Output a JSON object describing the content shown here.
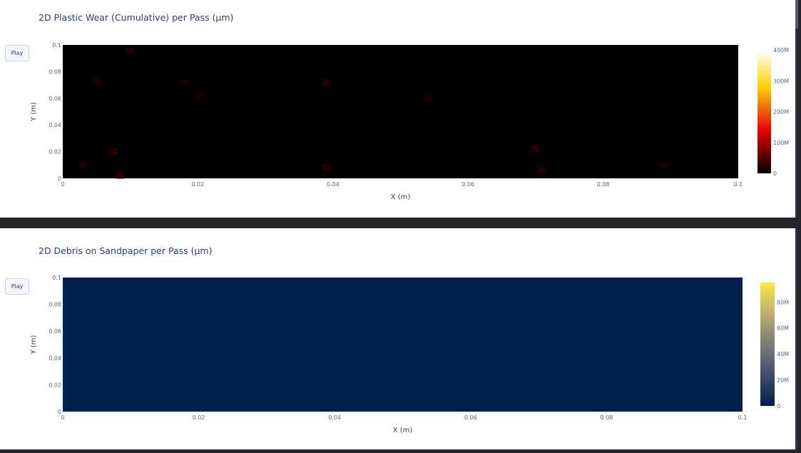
{
  "panels": [
    {
      "title": "2D Plastic Wear (Cumulative) per Pass (µm)",
      "play_label": "Play",
      "colorscale": "hot",
      "chart_data": {
        "type": "heatmap",
        "title": "2D Plastic Wear (Cumulative) per Pass (µm)",
        "xlabel": "X (m)",
        "ylabel": "Y (m)",
        "xlim": [
          0,
          0.1
        ],
        "ylim": [
          0,
          0.1
        ],
        "x_ticks": [
          "0",
          "0.02",
          "0.04",
          "0.06",
          "0.08",
          "0.1"
        ],
        "y_ticks": [
          "0",
          "0.02",
          "0.04",
          "0.06",
          "0.08",
          "0.1"
        ],
        "colorbar_range": [
          0,
          400000000
        ],
        "colorbar_ticks": [
          "0",
          "100M",
          "200M",
          "300M",
          "400M"
        ],
        "hotspots": [
          {
            "x": 0.0085,
            "y": 0.002,
            "v": 0.12
          },
          {
            "x": 0.0075,
            "y": 0.02,
            "v": 0.09
          },
          {
            "x": 0.01,
            "y": 0.096,
            "v": 0.08
          },
          {
            "x": 0.005,
            "y": 0.073,
            "v": 0.07
          },
          {
            "x": 0.018,
            "y": 0.072,
            "v": 0.06
          },
          {
            "x": 0.02,
            "y": 0.062,
            "v": 0.05
          },
          {
            "x": 0.039,
            "y": 0.072,
            "v": 0.07
          },
          {
            "x": 0.039,
            "y": 0.008,
            "v": 0.09
          },
          {
            "x": 0.054,
            "y": 0.06,
            "v": 0.05
          },
          {
            "x": 0.07,
            "y": 0.022,
            "v": 0.1
          },
          {
            "x": 0.071,
            "y": 0.006,
            "v": 0.08
          },
          {
            "x": 0.089,
            "y": 0.01,
            "v": 0.06
          },
          {
            "x": 0.003,
            "y": 0.01,
            "v": 0.07
          }
        ]
      }
    },
    {
      "title": "2D Debris on Sandpaper per Pass (µm)",
      "play_label": "Play",
      "colorscale": "cividis",
      "chart_data": {
        "type": "heatmap",
        "title": "2D Debris on Sandpaper per Pass (µm)",
        "xlabel": "X (m)",
        "ylabel": "Y (m)",
        "xlim": [
          0,
          0.1
        ],
        "ylim": [
          0,
          0.1
        ],
        "x_ticks": [
          "0",
          "0.02",
          "0.04",
          "0.06",
          "0.08",
          "0.1"
        ],
        "y_ticks": [
          "0",
          "0.02",
          "0.04",
          "0.06",
          "0.08",
          "0.1"
        ],
        "colorbar_range": [
          0,
          95000000
        ],
        "colorbar_ticks": [
          "0",
          "20M",
          "40M",
          "60M",
          "80M"
        ],
        "uniform_value": 0
      }
    }
  ]
}
